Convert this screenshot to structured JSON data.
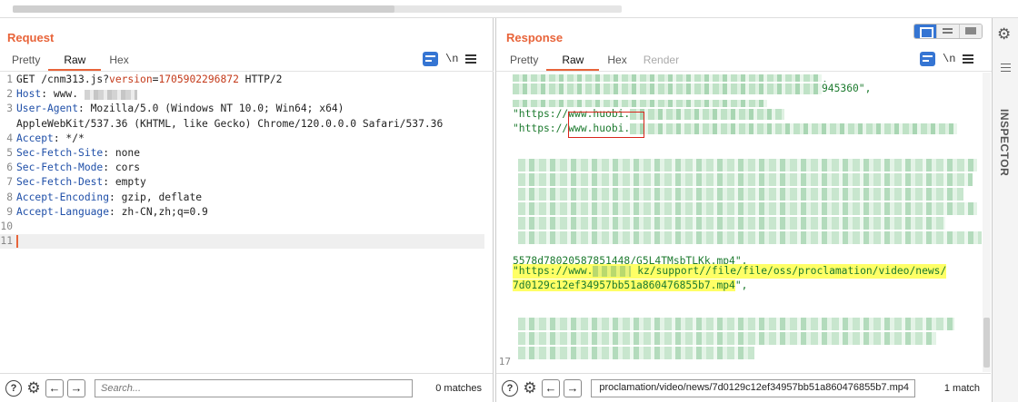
{
  "request": {
    "title": "Request",
    "tabs": [
      {
        "label": "Pretty"
      },
      {
        "label": "Raw"
      },
      {
        "label": "Hex"
      }
    ],
    "newline_toggle": "\\n",
    "lines": {
      "1_method": "GET /cnm313.js?",
      "1_param": "version",
      "1_eq": "=",
      "1_value": "1705902296872",
      "1_proto": " HTTP/2",
      "2_key": "Host",
      "2_val": ": www.",
      "3_key": "User-Agent",
      "3_val": ": Mozilla/5.0 (Windows NT 10.0; Win64; x64)",
      "3b_val": "AppleWebKit/537.36 (KHTML, like Gecko) Chrome/120.0.0.0 Safari/537.36",
      "4_key": "Accept",
      "4_val": ": */*",
      "5_key": "Sec-Fetch-Site",
      "5_val": ": none",
      "6_key": "Sec-Fetch-Mode",
      "6_val": ": cors",
      "7_key": "Sec-Fetch-Dest",
      "7_val": ": empty",
      "8_key": "Accept-Encoding",
      "8_val": ": gzip, deflate",
      "9_key": "Accept-Language",
      "9_val": ": zh-CN,zh;q=0.9"
    },
    "line_numbers": [
      "1",
      "2",
      "3",
      "",
      "4",
      "5",
      "6",
      "7",
      "8",
      "9",
      "10",
      "11"
    ],
    "search_placeholder": "Search...",
    "matches": "0 matches"
  },
  "response": {
    "title": "Response",
    "tabs": [
      {
        "label": "Pretty"
      },
      {
        "label": "Raw"
      },
      {
        "label": "Hex"
      },
      {
        "label": "Render"
      }
    ],
    "newline_toggle": "\\n",
    "lines": {
      "l1_tail": ",",
      "l2_tail": "945360\",",
      "l3_prefix": "\"https:",
      "l3_url": "//www.huobi.",
      "l4_prefix": "\"https:",
      "l4_url": "//www.huobi.",
      "l_mp4_tail": "5578d78020587851448/G5L4TMsbTLKk.mp4\",",
      "hl1_a": "\"https://www.",
      "hl1_b": " kz/support//file/file/oss/proclamation/video/news/",
      "hl2": "7d0129c12ef34957bb51a860476855b7.mp4",
      "hl2_tail": "\","
    },
    "last_line_number": "17",
    "search_value": "proclamation/video/news/7d0129c12ef34957bb51a860476855b7.mp4",
    "matches": "1 match"
  },
  "inspector": {
    "label": "INSPECTOR"
  },
  "colors": {
    "accent": "#e8643a",
    "key_blue": "#1f4fa8",
    "number_red": "#c43a1a",
    "string_green": "#1c7a2e",
    "toggle_blue": "#3575d3",
    "highlight": "#ffff66",
    "redbox": "#d9261c"
  },
  "icons": [
    "help-icon",
    "settings-gear-icon",
    "arrow-left-icon",
    "arrow-right-icon",
    "wrap-lines-icon",
    "menu-icon",
    "layout-split-icon",
    "layout-horizontal-icon",
    "layout-tabs-icon"
  ]
}
